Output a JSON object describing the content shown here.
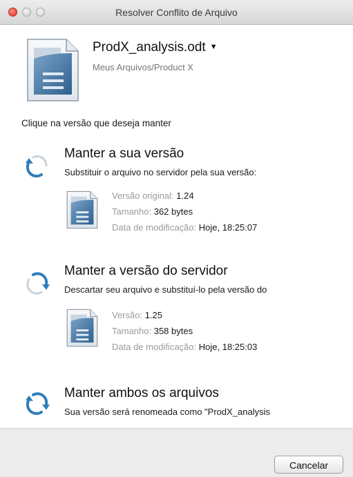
{
  "window": {
    "title": "Resolver Conflito de Arquivo"
  },
  "file": {
    "name": "ProdX_analysis.odt",
    "path": "Meus Arquivos/Product X",
    "icon": "document-icon"
  },
  "instruction": "Clique na versão que deseja manter",
  "options": {
    "keep_local": {
      "title": "Manter a sua versão",
      "description": "Substituir o arquivo no servidor pela sua versão:",
      "meta": [
        {
          "label": "Versão original:",
          "value": "1.24"
        },
        {
          "label": "Tamanho:",
          "value": "362 bytes"
        },
        {
          "label": "Data de modificação:",
          "value": "Hoje, 18:25:07"
        }
      ]
    },
    "keep_server": {
      "title": "Manter a versão do servidor",
      "description": "Descartar seu arquivo e substituí-lo pela versão do",
      "meta": [
        {
          "label": "Versão:",
          "value": "1.25"
        },
        {
          "label": "Tamanho:",
          "value": "358 bytes"
        },
        {
          "label": "Data de modificação:",
          "value": "Hoje, 18:25:03"
        }
      ]
    },
    "keep_both": {
      "title": "Manter ambos os arquivos",
      "description": "Sua versão será renomeada como \"ProdX_analysis"
    }
  },
  "footer": {
    "cancel_label": "Cancelar"
  },
  "colors": {
    "accent_blue": "#2f7fb8",
    "close_red": "#d9352b",
    "muted_text": "#9a9a9a"
  }
}
